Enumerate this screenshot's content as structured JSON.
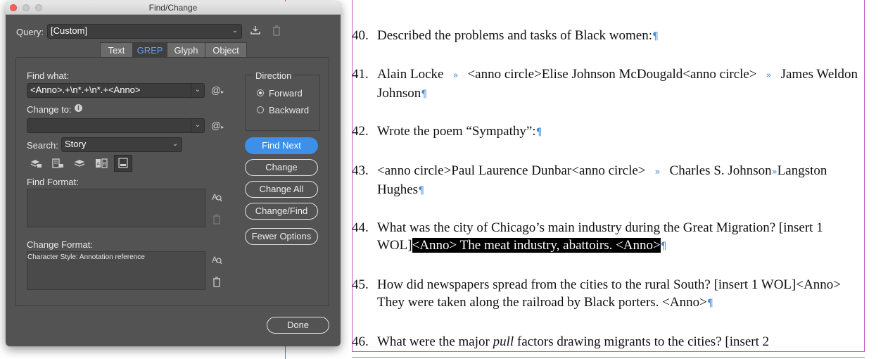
{
  "dialog": {
    "title": "Find/Change",
    "query_label": "Query:",
    "query_value": "[Custom]",
    "tabs": [
      {
        "label": "Text"
      },
      {
        "label": "GREP"
      },
      {
        "label": "Glyph"
      },
      {
        "label": "Object"
      }
    ],
    "active_tab": "GREP",
    "find_what_label": "Find what:",
    "find_what_value": "<Anno>.+\\n*.+\\n*.+<Anno>",
    "change_to_label": "Change to:",
    "change_to_value": "",
    "search_label": "Search:",
    "search_value": "Story",
    "find_format_label": "Find Format:",
    "change_format_label": "Change Format:",
    "change_format_value": "Character Style: Annotation reference",
    "direction_label": "Direction",
    "direction_options": [
      {
        "label": "Forward",
        "selected": true
      },
      {
        "label": "Backward",
        "selected": false
      }
    ],
    "buttons": {
      "find_next": "Find Next",
      "change": "Change",
      "change_all": "Change All",
      "change_find": "Change/Find",
      "fewer_options": "Fewer Options",
      "done": "Done"
    },
    "icons": {
      "save_query": "save-query-icon",
      "delete_query": "trash-icon",
      "special_chars": "at-symbol-icon",
      "info": "info-icon",
      "include_locked_layers": "locked-layers-icon",
      "include_locked_stories": "locked-stories-icon",
      "include_hidden_layers": "hidden-layers-icon",
      "include_master_pages": "master-pages-icon",
      "include_footnotes": "footnotes-icon",
      "specify_format": "specify-format-icon",
      "clear_format": "trash-icon"
    },
    "accent_color": "#3d8fe8"
  },
  "document": {
    "items": [
      {
        "number": "40.",
        "parts": [
          {
            "t": "Described the problems and tasks of Black women:"
          },
          {
            "pilcrow": "¶"
          }
        ]
      },
      {
        "number": "41.",
        "parts": [
          {
            "t": "Alain Locke"
          },
          {
            "tab": "»"
          },
          {
            "t": "<anno circle>Elise Johnson McDougald<anno circle>"
          },
          {
            "tab": "»"
          },
          {
            "t": "James Weldon Johnson"
          },
          {
            "pilcrow": "¶"
          }
        ]
      },
      {
        "number": "42.",
        "parts": [
          {
            "t": "Wrote the poem “Sympathy”:"
          },
          {
            "pilcrow": "¶"
          }
        ]
      },
      {
        "number": "43.",
        "parts": [
          {
            "t": "<anno circle>Paul Laurence Dunbar<anno circle>"
          },
          {
            "tab": "»"
          },
          {
            "t": "Charles S. Johnson"
          },
          {
            "tabshort": "»"
          },
          {
            "t": "Langston Hughes"
          },
          {
            "pilcrow": "¶"
          }
        ]
      },
      {
        "number": "44.",
        "parts": [
          {
            "t": "What was the city of Chicago’s main industry during the Great Migration? [insert 1 WOL]"
          },
          {
            "sel": "<Anno> The meat industry, abattoirs. <Anno>"
          },
          {
            "pilcrow": "¶"
          }
        ]
      },
      {
        "number": "45.",
        "parts": [
          {
            "t": "How did newspapers spread from the cities to the rural South? [insert 1 WOL]<Anno> They were taken along the railroad by Black porters. <Anno>"
          },
          {
            "pilcrow": "¶"
          }
        ]
      },
      {
        "number": "46.",
        "parts": [
          {
            "t": "What were the major "
          },
          {
            "i": "pull"
          },
          {
            "t": " factors drawing migrants to the cities? [insert 2"
          }
        ]
      }
    ],
    "colors": {
      "pilcrow": "#4a8ad8",
      "selection_bg": "#000000",
      "frame_guide": "#c44fc4",
      "margin_guide": "#e05555"
    }
  }
}
